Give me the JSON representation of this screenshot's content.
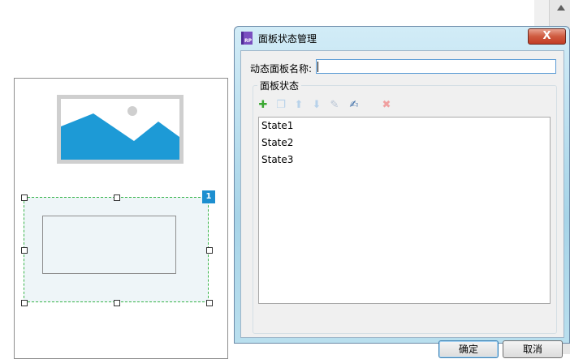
{
  "canvas": {
    "badge_number": "1"
  },
  "dialog": {
    "title": "面板状态管理",
    "app_icon_text": "RP",
    "close_symbol": "X",
    "name_label": "动态面板名称:",
    "name_value": "",
    "group_label": "面板状态",
    "toolbar": [
      {
        "name": "add-state-icon",
        "glyph": "✚",
        "color": "#3aa832"
      },
      {
        "name": "duplicate-state-icon",
        "glyph": "❐",
        "color": "#b8d2ea"
      },
      {
        "name": "move-up-icon",
        "glyph": "⬆",
        "color": "#b8d2ea"
      },
      {
        "name": "move-down-icon",
        "glyph": "⬇",
        "color": "#b8d2ea"
      },
      {
        "name": "edit-state-icon",
        "glyph": "✎",
        "color": "#b8c4d4"
      },
      {
        "name": "edit-all-states-icon",
        "glyph": "✍",
        "color": "#3f6fa8"
      },
      {
        "name": "delete-state-icon",
        "glyph": "✖",
        "color": "#f0a0a0"
      }
    ],
    "states": [
      "State1",
      "State2",
      "State3"
    ],
    "ok_label": "确定",
    "cancel_label": "取消"
  },
  "colors": {
    "image_blue": "#1d9ad6",
    "image_gray": "#cfcfcf",
    "selection_green": "#39b54a",
    "badge_blue": "#1d8fd0"
  }
}
